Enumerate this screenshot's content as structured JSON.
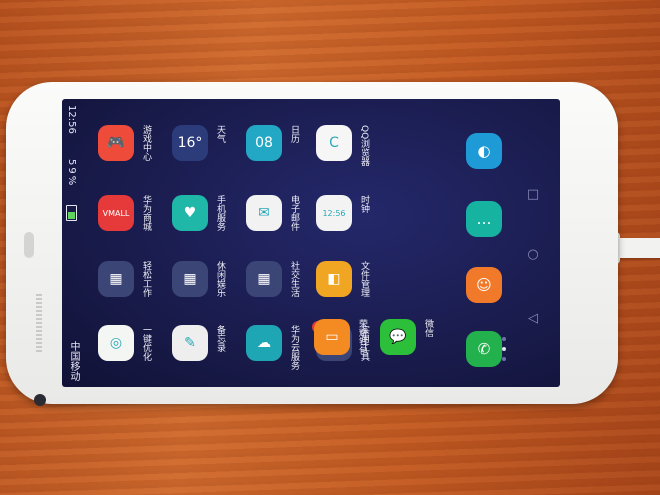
{
  "status_bar": {
    "time": "12:56",
    "battery": "59%",
    "carrier": "中国移动"
  },
  "apps": [
    {
      "name": "game-center",
      "label": "游戏中心",
      "icon": "gamepad-icon",
      "color": "#ee4b3b",
      "glyph": "🎮"
    },
    {
      "name": "huawei-store",
      "label": "华为商城",
      "icon": "vmall-icon",
      "color": "#e63a3a",
      "glyph": "VMALL"
    },
    {
      "name": "easy-work",
      "label": "轻松工作",
      "icon": "folder-icon",
      "color": "#3b4576",
      "glyph": "▦"
    },
    {
      "name": "one-click-optimize",
      "label": "一键优化",
      "icon": "optimize-icon",
      "color": "#f4f6f4",
      "glyph": "◎"
    },
    {
      "name": "weather",
      "label": "天气",
      "icon": "weather-icon",
      "color": "#2c3c7a",
      "glyph": "16°"
    },
    {
      "name": "phone-service",
      "label": "手机服务",
      "icon": "care-icon",
      "color": "#1fb8a8",
      "glyph": "♥"
    },
    {
      "name": "leisure",
      "label": "休闲娱乐",
      "icon": "folder-icon",
      "color": "#3b4576",
      "glyph": "▦"
    },
    {
      "name": "memo",
      "label": "备忘录",
      "icon": "memo-icon",
      "color": "#eeeeee",
      "glyph": "✎"
    },
    {
      "name": "calendar",
      "label": "日历",
      "icon": "calendar-icon",
      "color": "#22a8c4",
      "glyph": "08"
    },
    {
      "name": "email",
      "label": "电子邮件",
      "icon": "mail-icon",
      "color": "#f2f2f2",
      "glyph": "✉"
    },
    {
      "name": "social-life",
      "label": "社交生活",
      "icon": "folder-icon",
      "color": "#3b4576",
      "glyph": "▦"
    },
    {
      "name": "huawei-cloud",
      "label": "华为云服务",
      "icon": "cloud-icon",
      "color": "#1fa6b5",
      "glyph": "☁"
    },
    {
      "name": "qq-browser",
      "label": "QQ浏览器",
      "icon": "browser-icon",
      "color": "#f6f6f6",
      "glyph": "C"
    },
    {
      "name": "clock",
      "label": "时钟",
      "icon": "clock-icon",
      "color": "#f3f3f3",
      "glyph": "12:56"
    },
    {
      "name": "file-manager",
      "label": "文件管理",
      "icon": "folder-file-icon",
      "color": "#f0a623",
      "glyph": "◧"
    },
    {
      "name": "utilities",
      "label": "实用工具",
      "icon": "folder-icon",
      "color": "#3b4576",
      "glyph": "▦",
      "badge": "1"
    },
    {
      "name": "honor-wallet",
      "label": "荣耀钱包",
      "icon": "wallet-icon",
      "color": "#f38a22",
      "glyph": "▭"
    },
    {
      "name": "wechat",
      "label": "微信",
      "icon": "wechat-icon",
      "color": "#2bbf3a",
      "glyph": "💬"
    }
  ],
  "dock": [
    {
      "name": "browser",
      "icon": "globe-icon",
      "color": "#1e9bd6",
      "glyph": "◐"
    },
    {
      "name": "messages",
      "icon": "message-icon",
      "color": "#16b4a0",
      "glyph": "…"
    },
    {
      "name": "contacts",
      "icon": "contacts-icon",
      "color": "#f07a2a",
      "glyph": "☺"
    },
    {
      "name": "phone",
      "icon": "phone-icon",
      "color": "#22b14c",
      "glyph": "✆"
    }
  ],
  "nav_keys": [
    {
      "name": "recent-apps",
      "glyph": "□"
    },
    {
      "name": "home",
      "glyph": "○"
    },
    {
      "name": "back",
      "glyph": "◁"
    }
  ]
}
